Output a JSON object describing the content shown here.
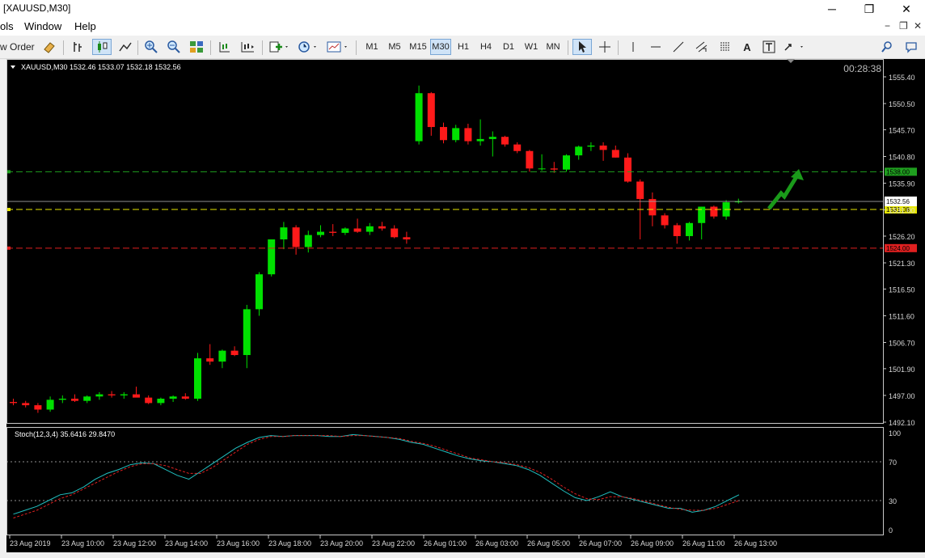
{
  "window": {
    "title": "[XAUUSD,M30]"
  },
  "menu": {
    "tools": "ols",
    "window": "Window",
    "help": "Help"
  },
  "toolbar": {
    "new_order": "w Order",
    "timeframes": [
      "M1",
      "M5",
      "M15",
      "M30",
      "H1",
      "H4",
      "D1",
      "W1",
      "MN"
    ],
    "selected_timeframe": "M30",
    "text_tool": "A"
  },
  "chart": {
    "info": "XAUUSD,M30  1532.46 1533.07 1532.18 1532.56",
    "timer": "00:28:38",
    "price_labels": [
      "1555.40",
      "1550.50",
      "1545.70",
      "1540.80",
      "1535.90",
      "1531.00",
      "1526.20",
      "1521.30",
      "1516.50",
      "1511.60",
      "1506.70",
      "1501.90",
      "1497.00",
      "1492.10"
    ],
    "current_price": "1532.56",
    "levels": [
      {
        "value": "1538.00",
        "color": "#1f9f1f"
      },
      {
        "value": "1531.08",
        "color": "#e6e600"
      },
      {
        "value": "1524.00",
        "color": "#e02020"
      }
    ],
    "stoch_label": "Stoch(12,3,4) 35.6416 29.8470",
    "stoch_scale": [
      "100",
      "70",
      "30",
      "0"
    ],
    "time_labels": [
      "23 Aug 2019",
      "23 Aug 10:00",
      "23 Aug 12:00",
      "23 Aug 14:00",
      "23 Aug 16:00",
      "23 Aug 18:00",
      "23 Aug 20:00",
      "23 Aug 22:00",
      "26 Aug 01:00",
      "26 Aug 03:00",
      "26 Aug 05:00",
      "26 Aug 07:00",
      "26 Aug 09:00",
      "26 Aug 11:00",
      "26 Aug 13:00"
    ]
  },
  "chart_data": {
    "type": "candlestick",
    "symbol": "XAUUSD",
    "timeframe": "M30",
    "ohlc": [
      [
        1495.8,
        1496.4,
        1495.2,
        1495.6
      ],
      [
        1495.6,
        1496.0,
        1494.8,
        1495.2
      ],
      [
        1495.2,
        1495.6,
        1493.8,
        1494.4
      ],
      [
        1494.4,
        1496.8,
        1494.0,
        1496.2
      ],
      [
        1496.2,
        1497.0,
        1495.6,
        1496.4
      ],
      [
        1496.4,
        1497.2,
        1495.8,
        1496.0
      ],
      [
        1496.0,
        1497.0,
        1495.6,
        1496.8
      ],
      [
        1496.8,
        1497.6,
        1496.2,
        1497.2
      ],
      [
        1497.2,
        1497.8,
        1496.6,
        1497.0
      ],
      [
        1497.0,
        1497.6,
        1496.4,
        1497.2
      ],
      [
        1497.2,
        1498.6,
        1496.8,
        1496.6
      ],
      [
        1496.6,
        1497.0,
        1495.4,
        1495.6
      ],
      [
        1495.6,
        1496.6,
        1495.2,
        1496.4
      ],
      [
        1496.4,
        1497.0,
        1495.8,
        1496.8
      ],
      [
        1496.8,
        1497.4,
        1496.2,
        1496.4
      ],
      [
        1496.4,
        1504.8,
        1496.0,
        1503.8
      ],
      [
        1503.8,
        1506.4,
        1502.6,
        1503.2
      ],
      [
        1503.2,
        1505.4,
        1502.0,
        1505.2
      ],
      [
        1505.2,
        1506.0,
        1504.2,
        1504.4
      ],
      [
        1504.4,
        1513.6,
        1502.0,
        1512.8
      ],
      [
        1512.8,
        1519.6,
        1511.6,
        1519.2
      ],
      [
        1519.2,
        1525.6,
        1518.8,
        1525.6
      ],
      [
        1525.6,
        1528.8,
        1523.8,
        1527.8
      ],
      [
        1527.8,
        1528.2,
        1522.8,
        1524.2
      ],
      [
        1524.2,
        1527.2,
        1523.2,
        1526.4
      ],
      [
        1526.4,
        1528.2,
        1526.0,
        1527.0
      ],
      [
        1527.0,
        1528.4,
        1526.2,
        1526.8
      ],
      [
        1526.8,
        1527.8,
        1526.4,
        1527.6
      ],
      [
        1527.6,
        1529.4,
        1526.8,
        1527.0
      ],
      [
        1527.0,
        1528.6,
        1526.4,
        1528.0
      ],
      [
        1528.0,
        1528.8,
        1527.2,
        1527.6
      ],
      [
        1527.6,
        1528.2,
        1525.8,
        1526.0
      ],
      [
        1526.0,
        1527.0,
        1524.8,
        1525.6
      ],
      [
        1543.6,
        1553.8,
        1543.0,
        1552.4
      ],
      [
        1552.4,
        1552.6,
        1544.6,
        1546.2
      ],
      [
        1546.2,
        1547.0,
        1543.2,
        1543.8
      ],
      [
        1543.8,
        1546.6,
        1543.4,
        1546.0
      ],
      [
        1546.0,
        1546.8,
        1543.0,
        1543.6
      ],
      [
        1543.6,
        1547.6,
        1542.8,
        1544.0
      ],
      [
        1544.0,
        1545.4,
        1540.8,
        1544.4
      ],
      [
        1544.4,
        1544.6,
        1542.6,
        1543.0
      ],
      [
        1543.0,
        1543.4,
        1541.4,
        1541.8
      ],
      [
        1541.8,
        1542.0,
        1538.0,
        1538.6
      ],
      [
        1538.6,
        1541.2,
        1538.2,
        1538.6
      ],
      [
        1538.6,
        1539.8,
        1537.8,
        1538.4
      ],
      [
        1538.4,
        1541.2,
        1538.0,
        1541.0
      ],
      [
        1541.0,
        1542.8,
        1540.2,
        1542.6
      ],
      [
        1542.6,
        1543.4,
        1541.8,
        1542.8
      ],
      [
        1542.8,
        1543.4,
        1540.0,
        1542.0
      ],
      [
        1542.0,
        1542.8,
        1540.6,
        1540.6
      ],
      [
        1540.6,
        1541.4,
        1536.0,
        1536.2
      ],
      [
        1536.2,
        1536.6,
        1525.6,
        1533.0
      ],
      [
        1533.0,
        1534.2,
        1528.0,
        1530.0
      ],
      [
        1530.0,
        1530.4,
        1527.6,
        1528.2
      ],
      [
        1528.2,
        1528.6,
        1524.8,
        1526.2
      ],
      [
        1526.2,
        1528.8,
        1525.4,
        1528.6
      ],
      [
        1528.6,
        1531.6,
        1525.6,
        1531.6
      ],
      [
        1531.6,
        1531.8,
        1529.4,
        1529.8
      ],
      [
        1529.8,
        1532.8,
        1529.2,
        1532.4
      ],
      [
        1532.4,
        1533.07,
        1532.18,
        1532.56
      ]
    ],
    "horizontal_levels": [
      1538.0,
      1531.08,
      1524.0
    ],
    "y_range": [
      1492.1,
      1555.4
    ],
    "stochastic": {
      "params": "12,3,4",
      "main": [
        16,
        20,
        24,
        30,
        36,
        38,
        44,
        52,
        58,
        62,
        67,
        69,
        68,
        62,
        56,
        52,
        60,
        68,
        76,
        84,
        90,
        95,
        97,
        96,
        97,
        97,
        97,
        96,
        96,
        98,
        97,
        96,
        95,
        93,
        90,
        88,
        84,
        80,
        76,
        73,
        71,
        70,
        68,
        66,
        62,
        56,
        48,
        40,
        33,
        30,
        34,
        39,
        34,
        31,
        28,
        25,
        22,
        22,
        18,
        20,
        24,
        30,
        36
      ],
      "signal": [
        12,
        16,
        20,
        26,
        32,
        36,
        42,
        48,
        54,
        60,
        65,
        68,
        68,
        66,
        62,
        58,
        58,
        64,
        72,
        80,
        88,
        93,
        96,
        96,
        97,
        97,
        97,
        97,
        96,
        97,
        97,
        96,
        95,
        94,
        91,
        89,
        86,
        82,
        78,
        74,
        72,
        70,
        69,
        67,
        64,
        59,
        52,
        44,
        37,
        32,
        31,
        34,
        34,
        32,
        29,
        26,
        23,
        21,
        20,
        20,
        22,
        26,
        30
      ],
      "levels": [
        70,
        30
      ],
      "range": [
        0,
        100
      ]
    }
  }
}
